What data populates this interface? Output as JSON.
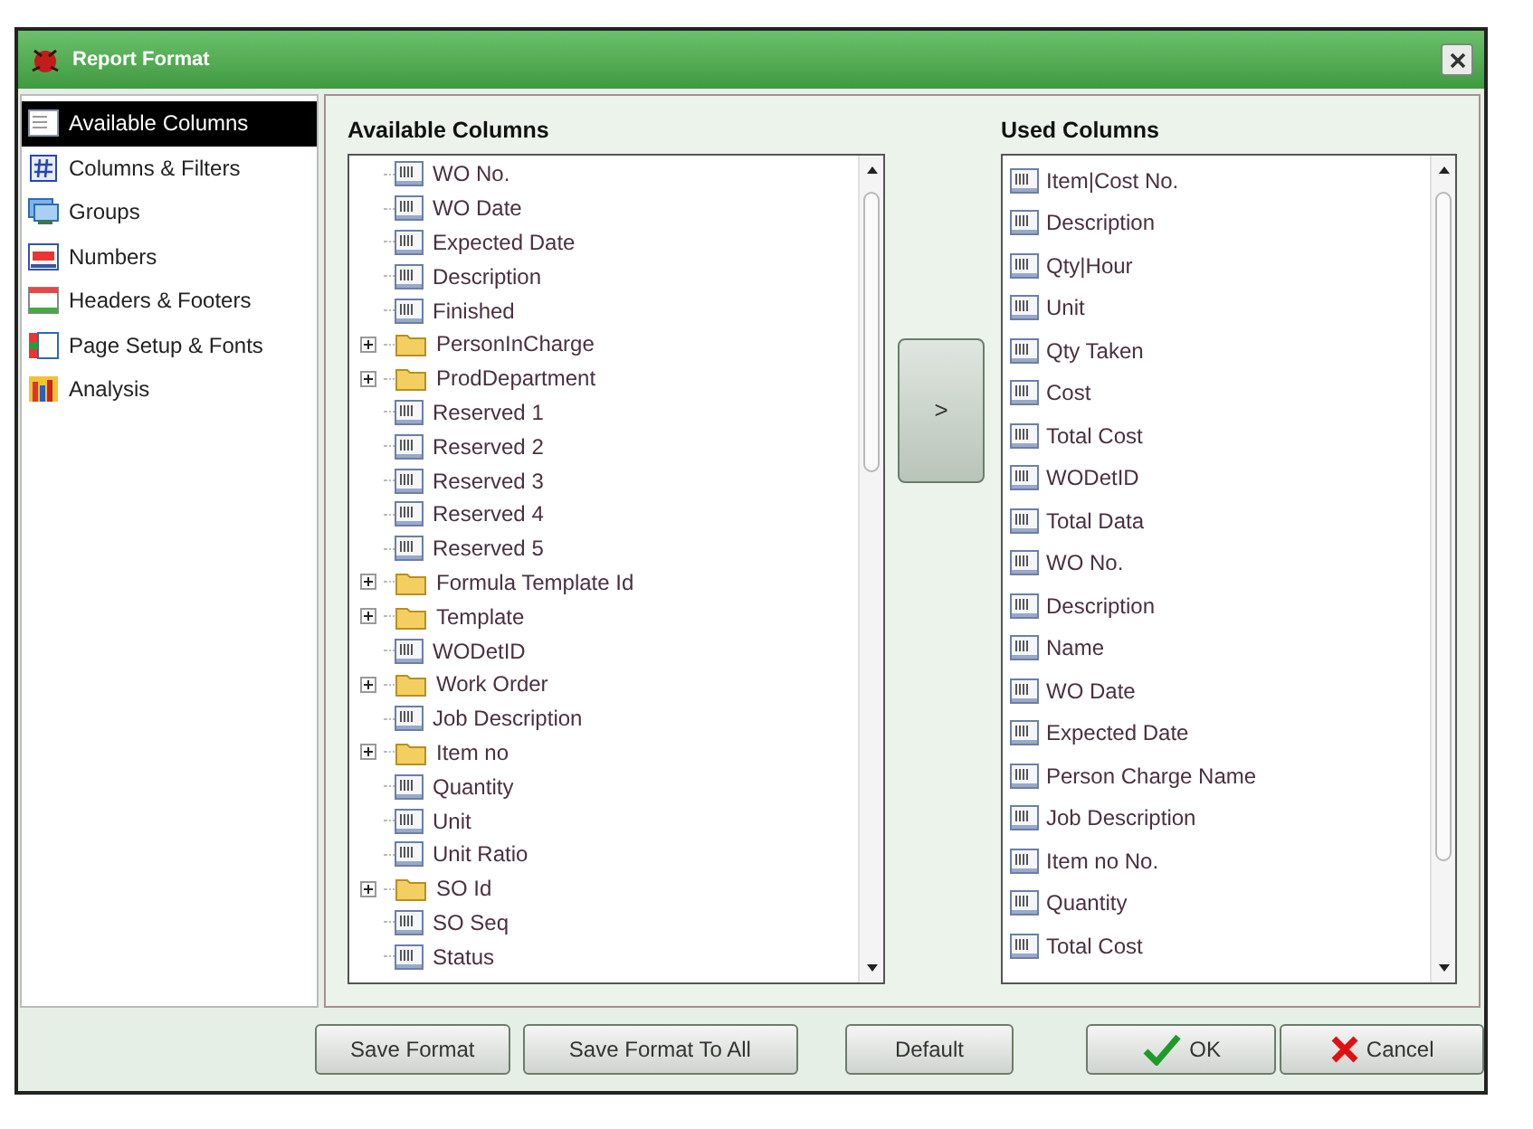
{
  "window": {
    "title": "Report Format"
  },
  "sidebar": {
    "items": [
      {
        "label": "Available Columns",
        "selected": true
      },
      {
        "label": "Columns & Filters",
        "selected": false
      },
      {
        "label": "Groups",
        "selected": false
      },
      {
        "label": "Numbers",
        "selected": false
      },
      {
        "label": "Headers & Footers",
        "selected": false
      },
      {
        "label": "Page Setup & Fonts",
        "selected": false
      },
      {
        "label": "Analysis",
        "selected": false
      }
    ]
  },
  "available": {
    "title": "Available Columns",
    "items": [
      {
        "label": "WO No.",
        "kind": "field"
      },
      {
        "label": "WO Date",
        "kind": "field"
      },
      {
        "label": "Expected Date",
        "kind": "field"
      },
      {
        "label": "Description",
        "kind": "field"
      },
      {
        "label": "Finished",
        "kind": "field"
      },
      {
        "label": "PersonInCharge",
        "kind": "folder"
      },
      {
        "label": "ProdDepartment",
        "kind": "folder"
      },
      {
        "label": "Reserved 1",
        "kind": "field"
      },
      {
        "label": "Reserved 2",
        "kind": "field"
      },
      {
        "label": "Reserved 3",
        "kind": "field"
      },
      {
        "label": "Reserved 4",
        "kind": "field"
      },
      {
        "label": "Reserved 5",
        "kind": "field"
      },
      {
        "label": "Formula Template Id",
        "kind": "folder"
      },
      {
        "label": "Template",
        "kind": "folder"
      },
      {
        "label": "WODetID",
        "kind": "field"
      },
      {
        "label": "Work Order",
        "kind": "folder"
      },
      {
        "label": "Job Description",
        "kind": "field"
      },
      {
        "label": "Item no",
        "kind": "folder"
      },
      {
        "label": "Quantity",
        "kind": "field"
      },
      {
        "label": "Unit",
        "kind": "field"
      },
      {
        "label": "Unit Ratio",
        "kind": "field"
      },
      {
        "label": "SO Id",
        "kind": "folder"
      },
      {
        "label": "SO Seq",
        "kind": "field"
      },
      {
        "label": "Status",
        "kind": "field"
      }
    ]
  },
  "move_button": ">",
  "used": {
    "title": "Used Columns",
    "items": [
      "Item|Cost No.",
      "Description",
      "Qty|Hour",
      "Unit",
      "Qty Taken",
      "Cost",
      "Total Cost",
      "WODetID",
      "Total Data",
      "WO No.",
      "Description",
      "Name",
      "WO Date",
      "Expected Date",
      "Person Charge Name",
      "Job Description",
      "Item no No.",
      "Quantity",
      "Total Cost"
    ]
  },
  "buttons": [
    {
      "label": "Save Format",
      "kind": "plain"
    },
    {
      "label": "Save Format To All",
      "kind": "plain"
    },
    {
      "label": "Default",
      "kind": "plain"
    },
    {
      "label": "OK",
      "kind": "ok"
    },
    {
      "label": "Cancel",
      "kind": "cancel"
    }
  ]
}
